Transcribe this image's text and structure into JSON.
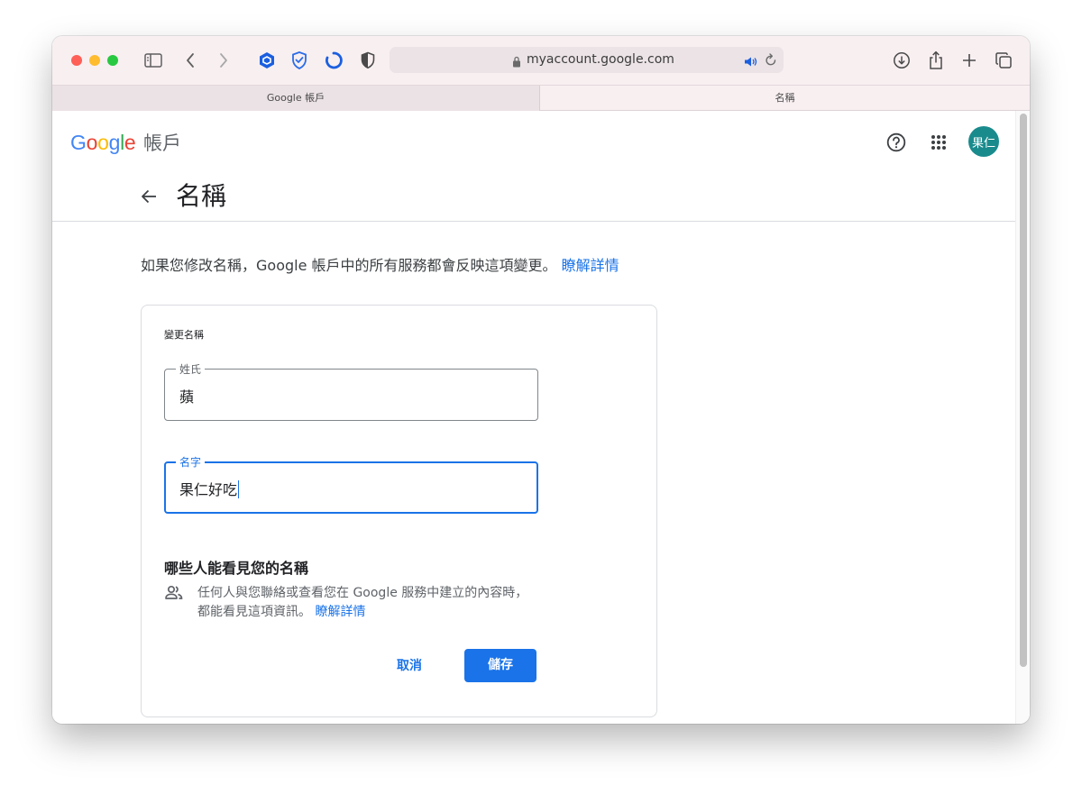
{
  "browser": {
    "url": "myaccount.google.com",
    "tabs": [
      {
        "label": "Google 帳戶",
        "active": false
      },
      {
        "label": "名稱",
        "active": true
      }
    ]
  },
  "header": {
    "logo_text": "Google",
    "product": "帳戶",
    "avatar_text": "果仁",
    "avatar_color": "#1a8b8d"
  },
  "page": {
    "title": "名稱",
    "intro": "如果您修改名稱，Google 帳戶中的所有服務都會反映這項變更。",
    "intro_link": "瞭解詳情"
  },
  "form": {
    "card_title": "變更名稱",
    "last_name": {
      "label": "姓氏",
      "value": "蘋"
    },
    "first_name": {
      "label": "名字",
      "value": "果仁好吃"
    },
    "visibility_title": "哪些人能看見您的名稱",
    "visibility_text": "任何人與您聯絡或查看您在 Google 服務中建立的內容時，都能看見這項資訊。",
    "visibility_link": "瞭解詳情",
    "cancel_label": "取消",
    "save_label": "儲存"
  },
  "colors": {
    "accent": "#1a73e8",
    "tab_bar": "#f8eff1"
  }
}
